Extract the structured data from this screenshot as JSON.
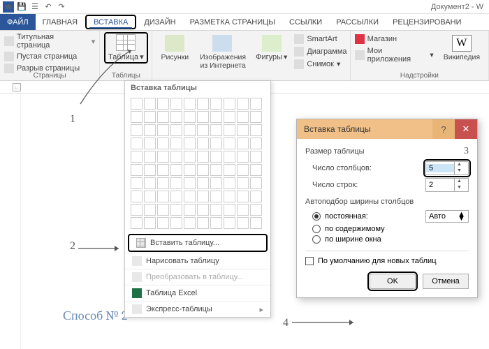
{
  "titlebar": {
    "doc": "Документ2 - W"
  },
  "tabs": {
    "file": "ФАЙЛ",
    "home": "ГЛАВНАЯ",
    "insert": "ВСТАВКА",
    "design": "ДИЗАЙН",
    "layout": "РАЗМЕТКА СТРАНИЦЫ",
    "refs": "ССЫЛКИ",
    "mail": "РАССЫЛКИ",
    "review": "РЕЦЕНЗИРОВАНИ"
  },
  "ribbon": {
    "pages": {
      "label": "Страницы",
      "cover": "Титульная страница",
      "blank": "Пустая страница",
      "break": "Разрыв страницы"
    },
    "tables": {
      "label": "Таблицы",
      "table": "Таблица"
    },
    "illus": {
      "pictures": "Рисунки",
      "online": "Изображения из Интернета",
      "shapes": "Фигуры",
      "smartart": "SmartArt",
      "chart": "Диаграмма",
      "screenshot": "Снимок"
    },
    "addins": {
      "label": "Надстройки",
      "store": "Магазин",
      "myapps": "Мои приложения",
      "wiki": "Википедия"
    }
  },
  "dropdown": {
    "title": "Вставка таблицы",
    "insert": "Вставить таблицу...",
    "draw": "Нарисовать таблицу",
    "convert": "Преобразовать в таблицу...",
    "excel": "Таблица Excel",
    "quick": "Экспресс-таблицы"
  },
  "dialog": {
    "title": "Вставка таблицы",
    "size_h": "Размер таблицы",
    "cols_l": "Число столбцов:",
    "cols_v": "5",
    "rows_l": "Число строк:",
    "rows_v": "2",
    "autofit_h": "Автоподбор ширины столбцов",
    "fixed": "постоянная:",
    "fixed_v": "Авто",
    "content": "по содержимому",
    "window": "по ширине окна",
    "remember": "По умолчанию для новых таблиц",
    "ok": "OK",
    "cancel": "Отмена"
  },
  "annot": {
    "n1": "1",
    "n2": "2",
    "n3": "3",
    "n4": "4",
    "caption": "Способ № 2"
  }
}
